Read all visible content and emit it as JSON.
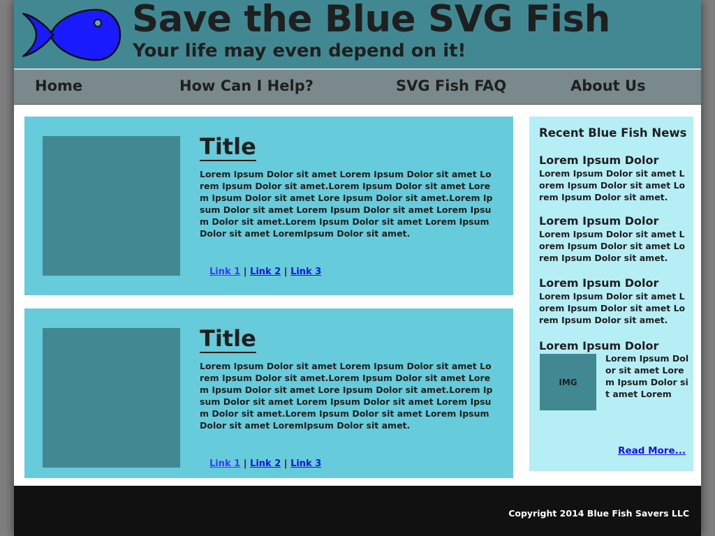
{
  "header": {
    "title": "Save the Blue SVG Fish",
    "tagline": "Your life may even depend on it!"
  },
  "nav": {
    "items": [
      {
        "label": "Home"
      },
      {
        "label": "How Can I Help?"
      },
      {
        "label": "SVG Fish FAQ"
      },
      {
        "label": "About Us"
      }
    ]
  },
  "articles": [
    {
      "title": "Title",
      "body": "Lorem Ipsum Dolor sit amet Lorem Ipsum Dolor sit amet Lorem Ipsum Dolor sit amet.Lorem Ipsum Dolor sit amet Lorem Ipsum Dolor sit amet Lore Ipsum Dolor sit amet.Lorem Ipsum Dolor sit amet Lorem Ipsum Dolor sit amet Lorem Ipsum Dolor sit amet.Lorem Ipsum Dolor sit amet Lorem Ipsum Dolor sit amet LoremIpsum Dolor sit amet.",
      "links": [
        "Link 1",
        "Link 2",
        "Link 3"
      ],
      "separator": "|"
    },
    {
      "title": "Title",
      "body": "Lorem Ipsum Dolor sit amet Lorem Ipsum Dolor sit amet Lorem Ipsum Dolor sit amet.Lorem Ipsum Dolor sit amet Lorem Ipsum Dolor sit amet Lore Ipsum Dolor sit amet.Lorem Ipsum Dolor sit amet Lorem Ipsum Dolor sit amet Lorem Ipsum Dolor sit amet.Lorem Ipsum Dolor sit amet Lorem Ipsum Dolor sit amet LoremIpsum Dolor sit amet.",
      "links": [
        "Link 1",
        "Link 2",
        "Link 3"
      ],
      "separator": "|"
    }
  ],
  "sidebar": {
    "heading": "Recent Blue Fish News",
    "news": [
      {
        "title": "Lorem Ipsum Dolor",
        "text": "Lorem Ipsum Dolor sit amet Lorem Ipsum Dolor sit amet Lorem Ipsum Dolor sit amet."
      },
      {
        "title": "Lorem Ipsum Dolor",
        "text": "Lorem Ipsum Dolor sit amet Lorem Ipsum Dolor sit amet Lorem Ipsum Dolor sit amet."
      },
      {
        "title": "Lorem Ipsum Dolor",
        "text": "Lorem Ipsum Dolor sit amet Lorem Ipsum Dolor sit amet Lorem Ipsum Dolor sit amet."
      },
      {
        "title": "Lorem Ipsum Dolor",
        "img_label": "IMG",
        "text": "Lorem Ipsum Dolor sit amet Lorem Ipsum Dolor sit amet Lorem"
      }
    ],
    "read_more": "Read More..."
  },
  "footer": {
    "copyright": "Copyright 2014 Blue Fish Savers LLC"
  },
  "colors": {
    "header": "#428892",
    "nav": "#7a8a8c",
    "article": "#66cbdb",
    "sidebar": "#b6eef5",
    "footer": "#111111",
    "fish": "#1a1aff",
    "link": "#1414dd"
  },
  "icons": {
    "logo": "blue-fish-icon"
  }
}
